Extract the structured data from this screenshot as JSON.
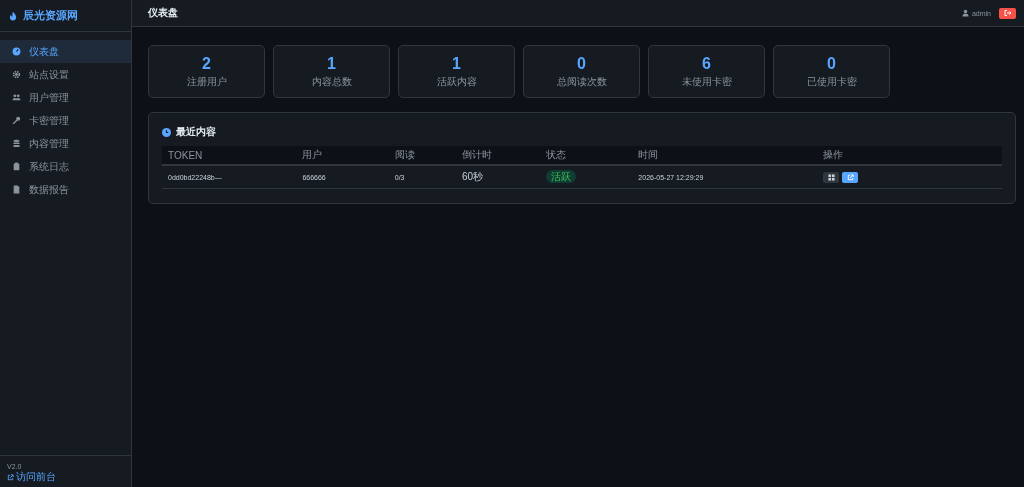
{
  "brand": "辰光资源网",
  "sidebar": {
    "items": [
      {
        "label": "仪表盘",
        "selected": true
      },
      {
        "label": "站点设置",
        "selected": false
      },
      {
        "label": "用户管理",
        "selected": false
      },
      {
        "label": "卡密管理",
        "selected": false
      },
      {
        "label": "内容管理",
        "selected": false
      },
      {
        "label": "系统日志",
        "selected": false
      },
      {
        "label": "数据报告",
        "selected": false
      }
    ],
    "version": "V2.0",
    "link": "访问前台"
  },
  "header": {
    "title": "仪表盘",
    "user": "admin"
  },
  "stats": [
    {
      "value": "2",
      "label": "注册用户"
    },
    {
      "value": "1",
      "label": "内容总数"
    },
    {
      "value": "1",
      "label": "活跃内容"
    },
    {
      "value": "0",
      "label": "总阅读次数"
    },
    {
      "value": "6",
      "label": "未使用卡密"
    },
    {
      "value": "0",
      "label": "已使用卡密"
    }
  ],
  "recent": {
    "title": "最近内容",
    "columns": [
      "TOKEN",
      "用户",
      "阅读",
      "倒计时",
      "状态",
      "时间",
      "操作"
    ],
    "rows": [
      {
        "token": "0dd0bd22248b—",
        "user": "666666",
        "reads": "0/3",
        "countdown": "60秒",
        "status": "活跃",
        "time": "2026-05-27 12:29:29"
      }
    ]
  }
}
